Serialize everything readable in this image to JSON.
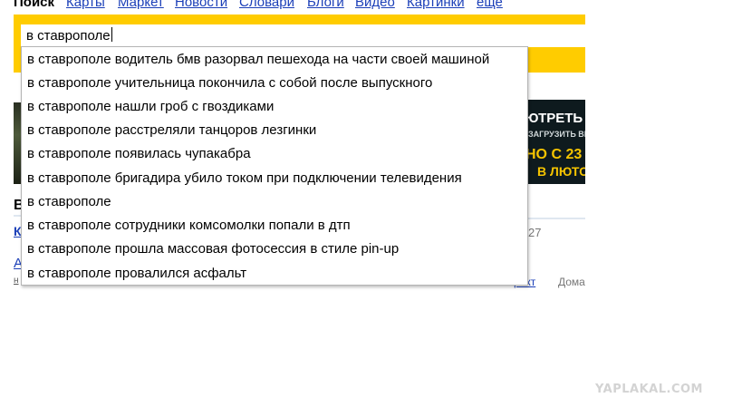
{
  "nav": {
    "current": "Поиск",
    "links": [
      "Карты",
      "Маркет",
      "Новости",
      "Словари",
      "Блоги",
      "Видео",
      "Картинки",
      "еще"
    ]
  },
  "search": {
    "value": "в ставрополе"
  },
  "suggestions": [
    "в ставрополе водитель бмв разорвал пешехода на части своей машиной",
    "в ставрополе учительница покончила с собой после выпускного",
    "в ставрополе нашли гроб с гвоздиками",
    "в ставрополе расстреляли танцоров лезгинки",
    "в ставрополе появилась чупакабра",
    "в ставрополе бригадира убило током при подключении телевидения",
    "в ставрополе",
    "в ставрополе сотрудники комсомолки попали в дтп",
    "в ставрополе прошла массовая фотосессия в стиле pin-up",
    "в ставрополе провалился асфальт"
  ],
  "banner": {
    "line1": "ЮТРЕТЬ",
    "line2": "ЗАГРУЗИТЬ ВИД",
    "line3": "НО С 23",
    "line4": "В ЛЮТО"
  },
  "background": {
    "bold_fragment": "В",
    "link_fragment_bold": "К",
    "link_fragment": "А",
    "small_fragment": "н",
    "number_fragment": "27",
    "trakt_fragment": "ракт",
    "doma_fragment": "Дома"
  },
  "watermark": "YAPLAKAL.COM",
  "colors": {
    "accent_yellow": "#ffcc00",
    "link_blue": "#1b3fb8"
  }
}
